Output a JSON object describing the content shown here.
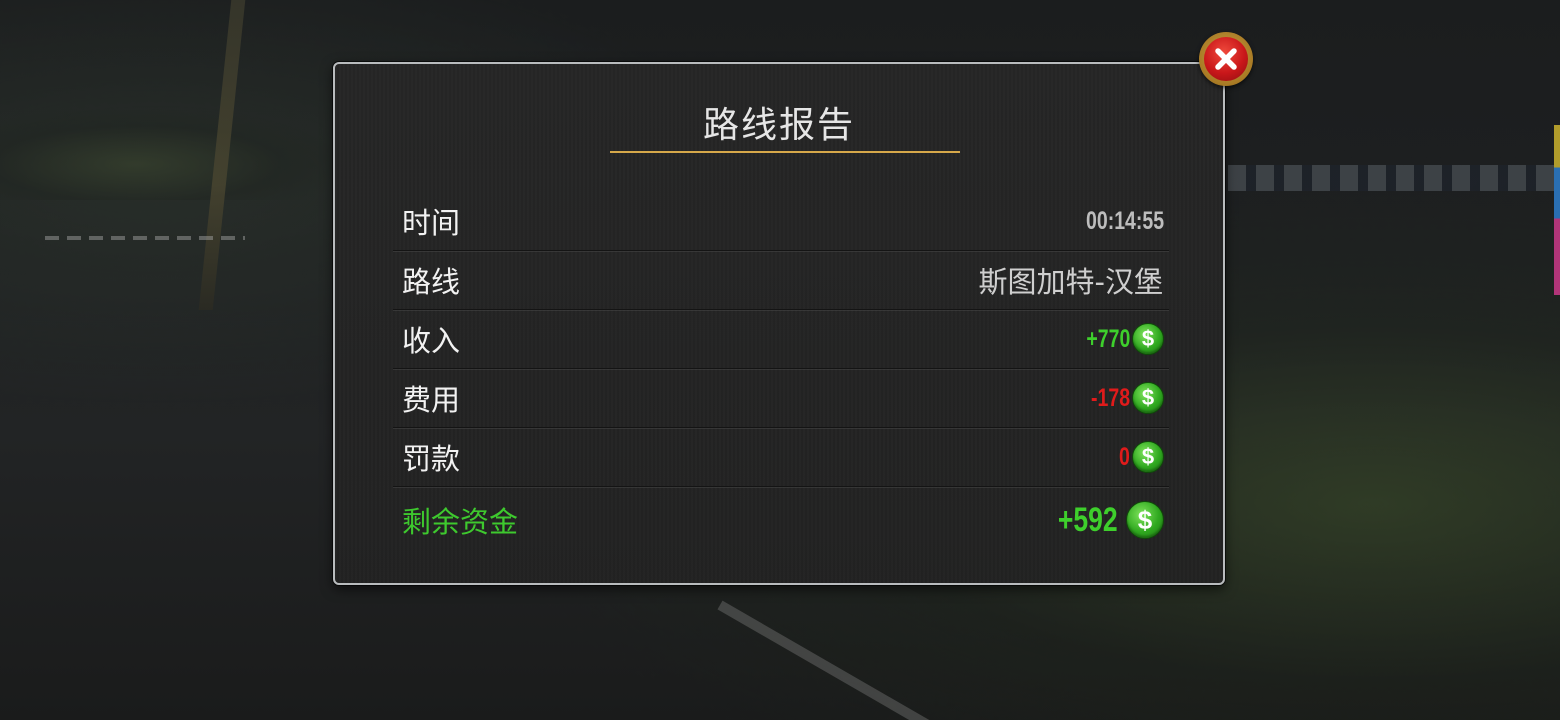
{
  "dialog": {
    "title": "路线报告",
    "rows": [
      {
        "label": "时间",
        "value": "00:14:55"
      },
      {
        "label": "路线",
        "value": "斯图加特-汉堡"
      },
      {
        "label": "收入",
        "value": "+770",
        "icon": "dollar-coin-icon"
      },
      {
        "label": "费用",
        "value": "-178",
        "icon": "dollar-coin-icon"
      },
      {
        "label": "罚款",
        "value": "0",
        "icon": "dollar-coin-icon"
      },
      {
        "label": "剩余资金",
        "value": "+592",
        "icon": "dollar-coin-icon"
      }
    ],
    "coin_symbol": "$",
    "close_icon": "close-icon"
  },
  "colors": {
    "accent_underline": "#d6a84a",
    "positive": "#3ecf2c",
    "negative": "#e01b1b",
    "close_red": "#c9171a"
  }
}
